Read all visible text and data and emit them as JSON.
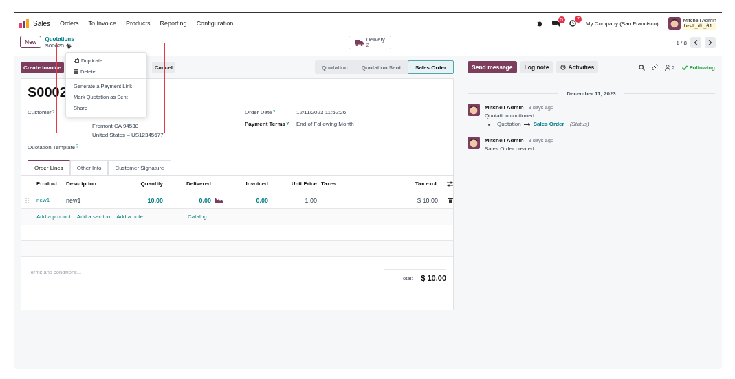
{
  "app": {
    "name": "Sales"
  },
  "menu": [
    "Orders",
    "To Invoice",
    "Products",
    "Reporting",
    "Configuration"
  ],
  "systray": {
    "messages_badge": "5",
    "activities_badge": "7",
    "company": "My Company (San Francisco)",
    "user": "Mitchell Admin",
    "database": "test_db_01"
  },
  "breadcrumb": {
    "new_button": "New",
    "parent": "Quotations",
    "current": "S00025"
  },
  "smart_button": {
    "label": "Delivery",
    "count": "2"
  },
  "pager": {
    "value": "1 / 8"
  },
  "actions": [
    {
      "label": "Create Invoice",
      "kind": "primary"
    },
    {
      "label": "Cancel",
      "kind": "secondary"
    }
  ],
  "statusbar": [
    {
      "label": "Quotation",
      "selected": false
    },
    {
      "label": "Quotation Sent",
      "selected": false
    },
    {
      "label": "Sales Order",
      "selected": true
    }
  ],
  "gear_menu": {
    "groups": [
      [
        {
          "label": "Duplicate",
          "kind": "copy"
        },
        {
          "label": "Delete",
          "kind": "trash"
        }
      ],
      [
        {
          "label": "Generate a Payment Link",
          "kind": "plain"
        },
        {
          "label": "Mark Quotation as Sent",
          "kind": "plain"
        },
        {
          "label": "Share",
          "kind": "plain"
        }
      ]
    ]
  },
  "form": {
    "title": "S0002",
    "customer": {
      "label": "Customer",
      "help": "?",
      "address": [
        "Fremont CA 94538",
        "United States – US12345677"
      ]
    },
    "right_fields": [
      {
        "label": "Order Date",
        "help": "?",
        "value": "12/11/2023 11:52:26",
        "required": false
      },
      {
        "label": "Payment Terms",
        "help": "?",
        "value": "End of Following Month",
        "required": true
      }
    ],
    "template": {
      "label": "Quotation Template",
      "help": "?"
    },
    "tabs": [
      {
        "label": "Order Lines",
        "selected": true
      },
      {
        "label": "Other Info",
        "selected": false
      },
      {
        "label": "Customer Signature",
        "selected": false
      }
    ],
    "columns": [
      "Product",
      "Description",
      "Quantity",
      "Delivered",
      "Invoiced",
      "Unit Price",
      "Taxes",
      "Tax excl."
    ],
    "rows": [
      {
        "product": "new1",
        "description": "new1",
        "quantity": "10.00",
        "delivered": "0.00",
        "invoiced": "0.00",
        "unit_price": "1.00",
        "subtotal": "$ 10.00"
      }
    ],
    "add_links": [
      "Add a product",
      "Add a section",
      "Add a note",
      "Catalog"
    ],
    "terms_placeholder": "Terms and conditions...",
    "total": {
      "label": "Total:",
      "value": "$ 10.00"
    }
  },
  "chatter": {
    "buttons": [
      {
        "label": "Send message",
        "kind": "primary"
      },
      {
        "label": "Log note",
        "kind": "secondary"
      },
      {
        "label": "Activities",
        "kind": "activities"
      }
    ],
    "followers_count": "2",
    "following": "Following",
    "date": "December 11, 2023",
    "messages": [
      {
        "author": "Mitchell Admin",
        "time": "- 3 days ago",
        "body": "Quotation confirmed",
        "tracking": {
          "old": "Quotation",
          "new": "Sales Order",
          "field": "(Status)"
        }
      },
      {
        "author": "Mitchell Admin",
        "time": "- 3 days ago",
        "body": "Sales Order created"
      }
    ]
  }
}
